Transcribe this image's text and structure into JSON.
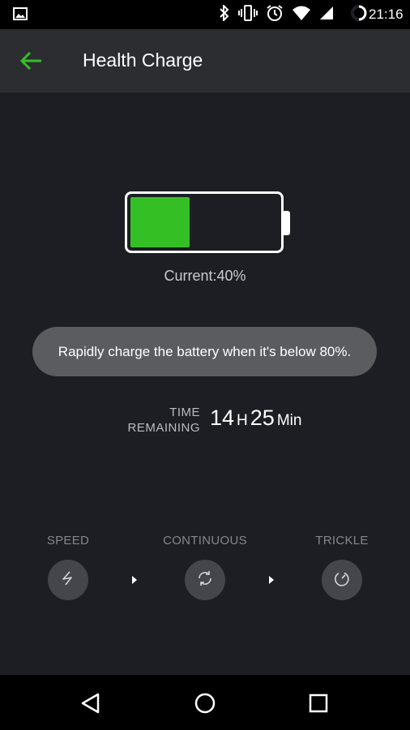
{
  "status_bar": {
    "time": "21:16",
    "icons": [
      "gallery-icon",
      "bluetooth-icon",
      "vibrate-icon",
      "alarm-icon",
      "wifi-icon",
      "signal-icon",
      "battery-saver-icon"
    ]
  },
  "app_bar": {
    "title": "Health Charge"
  },
  "battery": {
    "level": 0.4,
    "current_label": "Current:40%",
    "fill_color": "#34c025"
  },
  "toast": {
    "message": "Rapidly charge the battery when it's below 80%."
  },
  "time_remaining": {
    "label_line1": "TIME",
    "label_line2": "REMAINING",
    "hours": "14",
    "hours_unit": "H",
    "minutes": "25",
    "minutes_unit": "Min"
  },
  "modes": [
    {
      "label": "SPEED",
      "icon": "lightning-icon"
    },
    {
      "label": "CONTINUOUS",
      "icon": "refresh-icon"
    },
    {
      "label": "TRICKLE",
      "icon": "trickle-icon"
    }
  ],
  "colors": {
    "accent": "#34c025",
    "background": "#1c1e24",
    "app_bar": "#2b2d31"
  }
}
